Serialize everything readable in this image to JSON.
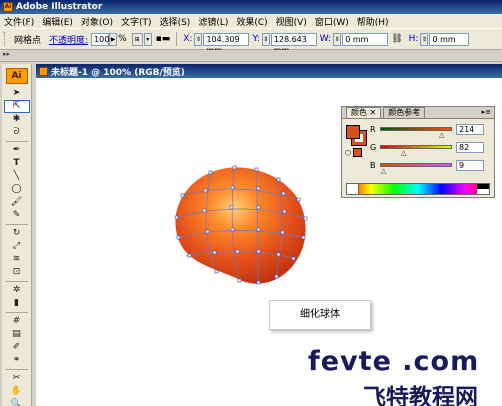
{
  "window": {
    "title": "Adobe Illustrator"
  },
  "menu": [
    "文件(F)",
    "编辑(E)",
    "对象(O)",
    "文字(T)",
    "选择(S)",
    "滤镜(L)",
    "效果(C)",
    "视图(V)",
    "窗口(W)",
    "帮助(H)"
  ],
  "control": {
    "mode_label": "网格点",
    "opacity_label": "不透明度:",
    "opacity_value": "100",
    "opacity_unit": "%",
    "x_label": "X:",
    "x_value": "104.309 mm",
    "y_label": "Y:",
    "y_value": "128.643 mm",
    "w_label": "W:",
    "w_value": "0 mm",
    "h_label": "H:",
    "h_value": "0 mm"
  },
  "toolbox": {
    "logo": "Ai"
  },
  "document": {
    "title": "未标题-1 @ 100% (RGB/预览)"
  },
  "color_panel": {
    "tab_color": "颜色",
    "tab_guide": "颜色参考",
    "r": {
      "label": "R",
      "value": "214"
    },
    "g": {
      "label": "G",
      "value": "82"
    },
    "b": {
      "label": "B",
      "value": "9"
    },
    "fill_color": "#d6521a"
  },
  "tooltip": "细化球体",
  "watermark": {
    "line1": "fevte .com",
    "line2": "飞特教程网"
  }
}
